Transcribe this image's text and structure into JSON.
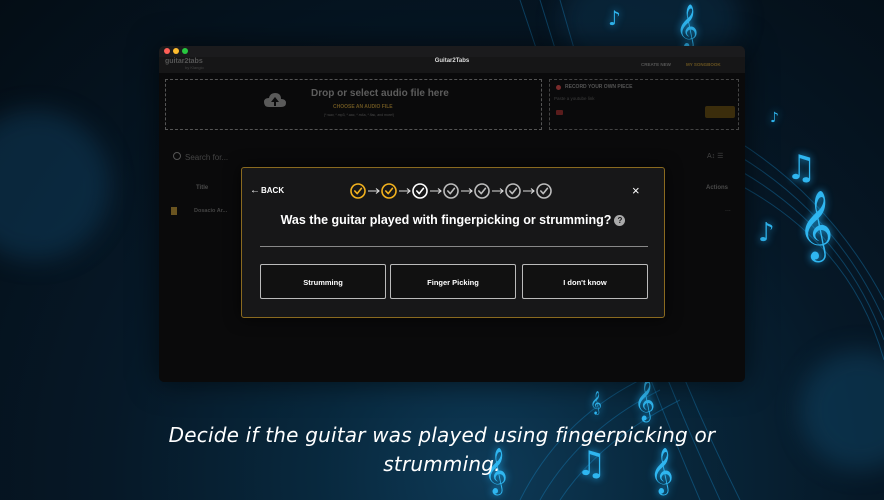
{
  "window": {
    "app_title": "Guitar2Tabs",
    "logo": "guitar2tabs",
    "logo_sub": "by Klangio",
    "nav": {
      "create_new": "CREATE NEW",
      "my_songbook": "MY SONGBOOK"
    },
    "traffic_lights": [
      "#ff5f57",
      "#febc2e",
      "#28c840"
    ]
  },
  "upload": {
    "title": "Drop or select audio file here",
    "choose_label": "CHOOSE AN AUDIO FILE",
    "formats": "(*.wav, *.mp3, *.aac, *.m4a, *.flac, and more!)"
  },
  "record": {
    "label": "RECORD YOUR OWN PIECE",
    "youtube_placeholder": "Paste a youtube link"
  },
  "list": {
    "search_placeholder": "Search for...",
    "col_title": "Title",
    "col_actions": "Actions",
    "rows": [
      {
        "name": "Dosacio Ar..."
      }
    ],
    "more": "..."
  },
  "modal": {
    "back_label": "BACK",
    "question": "Was the guitar played with fingerpicking or strumming?",
    "help": "?",
    "close": "×",
    "steps": [
      {
        "state": "done"
      },
      {
        "state": "done"
      },
      {
        "state": "current"
      },
      {
        "state": "pending"
      },
      {
        "state": "pending"
      },
      {
        "state": "pending"
      },
      {
        "state": "pending"
      }
    ],
    "options": [
      {
        "label": "Strumming"
      },
      {
        "label": "Finger Picking"
      },
      {
        "label": "I don't know"
      }
    ],
    "accent_color": "#f3b21e",
    "border_color": "#8a6a1f"
  },
  "caption": {
    "line1": "Decide if the guitar was played using fingerpicking or",
    "line2": "strumming."
  }
}
